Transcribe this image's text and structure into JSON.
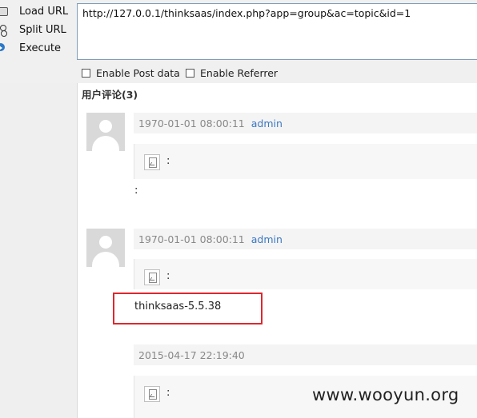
{
  "hackbar": {
    "load_url_label": "Load URL",
    "split_url_label": "Split URL",
    "execute_label": "Execute",
    "url_value": "http://127.0.0.1/thinksaas/index.php?app=group&ac=topic&id=1",
    "enable_post_label": "Enable Post data",
    "enable_referrer_label": "Enable Referrer"
  },
  "page": {
    "section_title": "用户评论(3)",
    "comments": [
      {
        "datetime": "1970-01-01 08:00:11",
        "author": "admin",
        "quote_colon": ":",
        "body": ":"
      },
      {
        "datetime": "1970-01-01 08:00:11",
        "author": "admin",
        "quote_colon": ":",
        "body": "thinksaas-5.5.38"
      },
      {
        "datetime": "2015-04-17 22:19:40",
        "author": "",
        "quote_colon": ":",
        "body": ""
      }
    ]
  },
  "watermark": "www.wooyun.org",
  "colors": {
    "highlight": "#e0262d",
    "author_link": "#3a78c3"
  }
}
